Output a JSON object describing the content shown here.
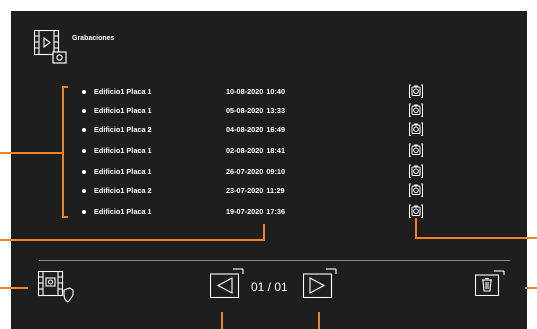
{
  "header": {
    "title": "Grabaciones",
    "icon": "recordings-film-camera-icon"
  },
  "recordings": [
    {
      "name": "Edificio1 Placa 1",
      "datetime": "10-08-2020  10:40",
      "icon": "camera-icon"
    },
    {
      "name": "Edificio1 Placa 1",
      "datetime": "05-08-2020  13:33",
      "icon": "camera-icon"
    },
    {
      "name": "Edificio1 Placa 2",
      "datetime": "04-08-2020  16:49",
      "icon": "camera-icon"
    },
    {
      "name": "Edificio1 Placa 1",
      "datetime": "02-08-2020  18:41",
      "icon": "camera-icon"
    },
    {
      "name": "Edificio1 Placa 1",
      "datetime": "26-07-2020  09:10",
      "icon": "camera-icon"
    },
    {
      "name": "Edificio1 Placa 2",
      "datetime": "23-07-2020  11:29",
      "icon": "camera-icon"
    },
    {
      "name": "Edificio1 Placa 1",
      "datetime": "19-07-2020  17:36",
      "icon": "camera-icon"
    }
  ],
  "footer": {
    "protect_icon": "film-camera-shield-icon",
    "prev_icon": "chevron-left-icon",
    "page_indicator": "01 / 01",
    "next_icon": "chevron-right-icon",
    "delete_icon": "trash-icon"
  },
  "colors": {
    "screen_bg": "#1e1e1e",
    "callout": "#ee8425",
    "text": "#ffffff",
    "divider": "#8a8a8a"
  }
}
